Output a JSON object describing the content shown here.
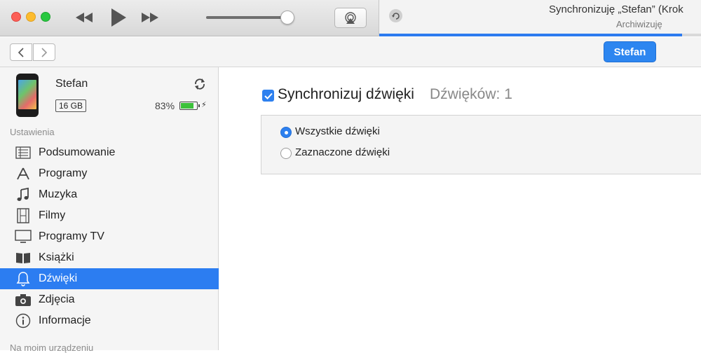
{
  "window": {
    "lcd_title": "Synchronizuję „Stefan” (Krok",
    "lcd_subtitle": "Archiwizuję",
    "progress_percent": 94
  },
  "navbar": {
    "back_label": "<",
    "forward_label": ">",
    "device_button_label": "Stefan"
  },
  "device": {
    "name": "Stefan",
    "capacity": "16 GB",
    "battery_percent": "83%",
    "battery_level": 0.83
  },
  "sidebar": {
    "settings_label": "Ustawienia",
    "items": [
      {
        "label": "Podsumowanie",
        "icon": "list-icon"
      },
      {
        "label": "Programy",
        "icon": "apps-icon"
      },
      {
        "label": "Muzyka",
        "icon": "music-note-icon"
      },
      {
        "label": "Filmy",
        "icon": "film-icon"
      },
      {
        "label": "Programy TV",
        "icon": "tv-icon"
      },
      {
        "label": "Książki",
        "icon": "book-icon"
      },
      {
        "label": "Dźwięki",
        "icon": "bell-icon",
        "selected": true
      },
      {
        "label": "Zdjęcia",
        "icon": "camera-icon"
      },
      {
        "label": "Informacje",
        "icon": "info-icon"
      }
    ],
    "on_device_label": "Na moim urządzeniu"
  },
  "main": {
    "sync_label": "Synchronizuj dźwięki",
    "sync_count": "Dźwięków: 1",
    "sync_checked": true,
    "options": [
      {
        "label": "Wszystkie dźwięki",
        "checked": true
      },
      {
        "label": "Zaznaczone dźwięki",
        "checked": false
      }
    ]
  },
  "colors": {
    "accent": "#2c7df1",
    "battery": "#3cc13b"
  }
}
